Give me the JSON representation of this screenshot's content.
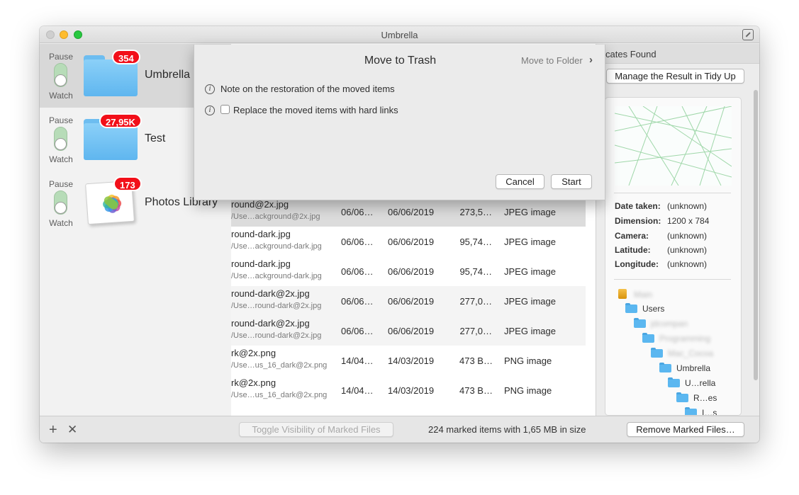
{
  "window": {
    "title": "Umbrella"
  },
  "sources": [
    {
      "name": "Umbrella",
      "badge": "354",
      "pause_label": "Pause",
      "watch_label": "Watch",
      "icon": "folder-icon"
    },
    {
      "name": "Test",
      "badge": "27,95K",
      "pause_label": "Pause",
      "watch_label": "Watch",
      "icon": "folder-icon"
    },
    {
      "name": "Photos Library",
      "badge": "173",
      "pause_label": "Pause",
      "watch_label": "Watch",
      "icon": "photos-icon"
    }
  ],
  "table": {
    "rows": [
      {
        "name": "round@2x.jpg",
        "path": "/Use…ackground@2x.jpg",
        "date1": "06/06…",
        "date2": "06/06/2019",
        "size": "273,5…",
        "kind": "JPEG image"
      },
      {
        "name": "round-dark.jpg",
        "path": "/Use…ackground-dark.jpg",
        "date1": "06/06…",
        "date2": "06/06/2019",
        "size": "95,74…",
        "kind": "JPEG image"
      },
      {
        "name": "round-dark.jpg",
        "path": "/Use…ackground-dark.jpg",
        "date1": "06/06…",
        "date2": "06/06/2019",
        "size": "95,74…",
        "kind": "JPEG image"
      },
      {
        "name": "round-dark@2x.jpg",
        "path": "/Use…round-dark@2x.jpg",
        "date1": "06/06…",
        "date2": "06/06/2019",
        "size": "277,0…",
        "kind": "JPEG image"
      },
      {
        "name": "round-dark@2x.jpg",
        "path": "/Use…round-dark@2x.jpg",
        "date1": "06/06…",
        "date2": "06/06/2019",
        "size": "277,0…",
        "kind": "JPEG image"
      },
      {
        "name": "rk@2x.png",
        "path": "/Use…us_16_dark@2x.png",
        "date1": "14/04…",
        "date2": "14/03/2019",
        "size": "473 B…",
        "kind": "PNG image"
      },
      {
        "name": "rk@2x.png",
        "path": "/Use…us_16_dark@2x.png",
        "date1": "14/04…",
        "date2": "14/03/2019",
        "size": "473 B…",
        "kind": "PNG image"
      }
    ]
  },
  "right_pane": {
    "header": "plicates Found",
    "manage_button": "Manage the Result in Tidy Up",
    "meta": [
      {
        "key": "Date taken:",
        "value": "(unknown)"
      },
      {
        "key": "Dimension:",
        "value": "1200 x 784"
      },
      {
        "key": "Camera:",
        "value": "(unknown)"
      },
      {
        "key": "Latitude:",
        "value": "(unknown)"
      },
      {
        "key": "Longitude:",
        "value": "(unknown)"
      }
    ],
    "tree": [
      {
        "label": "Main",
        "blurred": true,
        "icon": "disk-icon"
      },
      {
        "label": "Users",
        "blurred": false,
        "icon": "folder-icon"
      },
      {
        "label": "jdcompan",
        "blurred": true,
        "icon": "folder-icon"
      },
      {
        "label": "Programming",
        "blurred": true,
        "icon": "folder-icon"
      },
      {
        "label": "Mac_Cocoa",
        "blurred": true,
        "icon": "folder-icon"
      },
      {
        "label": "Umbrella",
        "blurred": false,
        "icon": "folder-icon"
      },
      {
        "label": "U…rella",
        "blurred": false,
        "icon": "folder-icon"
      },
      {
        "label": "R…es",
        "blurred": false,
        "icon": "folder-icon"
      },
      {
        "label": "I…s",
        "blurred": false,
        "icon": "folder-icon"
      }
    ]
  },
  "bottom": {
    "toggle_button": "Toggle Visibility of Marked Files",
    "status": "224 marked items with 1,65 MB in size",
    "remove_button": "Remove Marked Files…"
  },
  "sheet": {
    "title": "Move to Trash",
    "move_to_folder": "Move to Folder",
    "note": "Note on the restoration of the moved items",
    "hardlinks": "Replace the moved items with hard links",
    "hardlinks_checked": false,
    "cancel": "Cancel",
    "start": "Start"
  }
}
